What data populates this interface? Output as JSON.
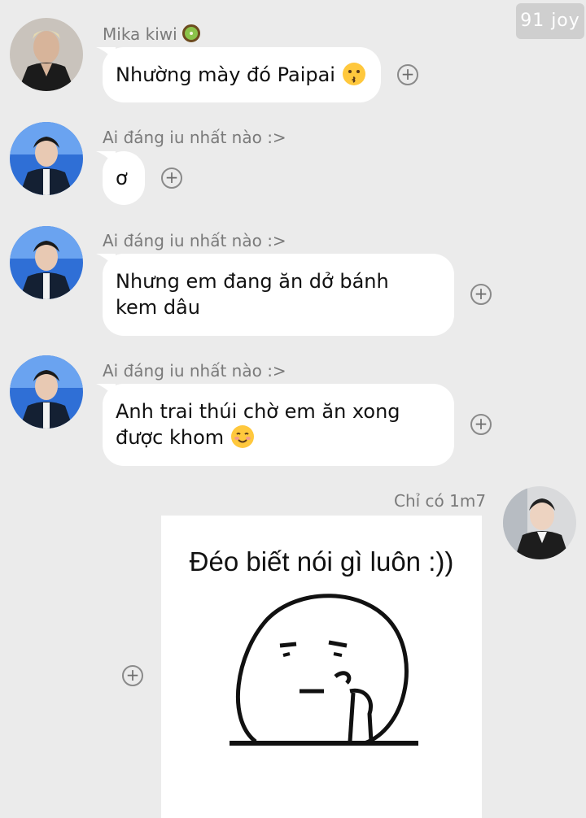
{
  "watermark": "91 joy",
  "messages": [
    {
      "sender": "Mika kiwi",
      "sender_suffix_icon": "kiwi-icon",
      "text": "Nhường mày đó Paipai",
      "emoji": "kissing-face-icon"
    },
    {
      "sender": "Ai đáng iu nhất nào :>",
      "text": "ơ"
    },
    {
      "sender": "Ai đáng iu nhất nào :>",
      "text_line1": "Nhưng em đang ăn dở bánh",
      "text_line2": "kem dâu"
    },
    {
      "sender": "Ai đáng iu nhất nào :>",
      "text_line1": "Anh trai thúi chờ em ăn xong",
      "text_line2": "được khom",
      "emoji": "smiling-face-icon"
    },
    {
      "sender": "Chỉ có 1m7",
      "sticker_caption": "Đéo biết nói gì luôn :))"
    }
  ],
  "plus_symbol": "+",
  "colors": {
    "background": "#ebebeb",
    "bubble": "#ffffff",
    "sender_name": "#7a7a7a",
    "watermark_bg": "#cfcfcf"
  }
}
